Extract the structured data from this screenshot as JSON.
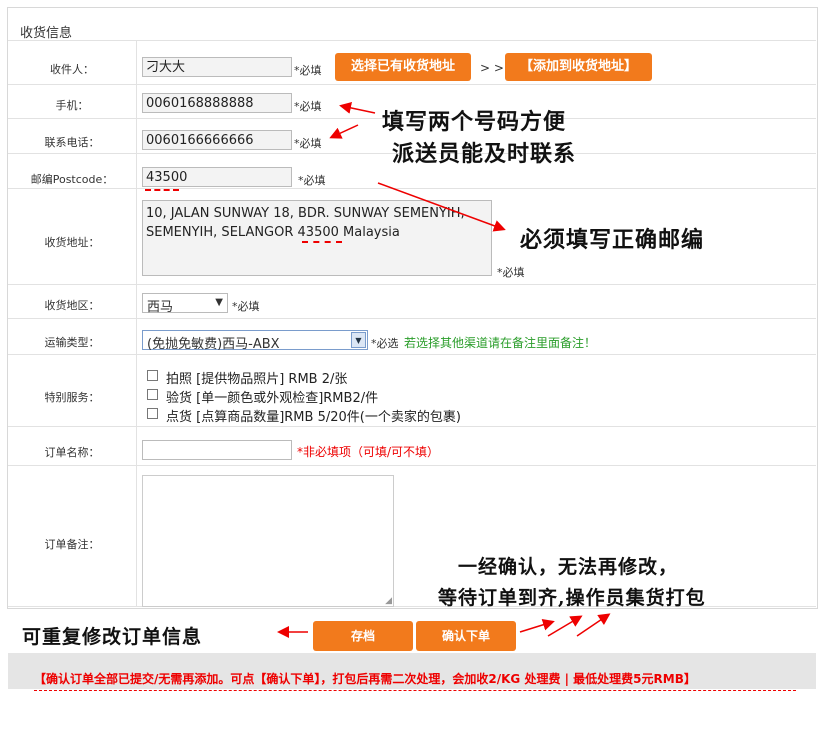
{
  "section_title": "收货信息",
  "recipient": {
    "label": "收件人：",
    "value": "刁大大",
    "req": "*必填"
  },
  "btn_select_address": "选择已有收货地址",
  "arrows_text": "> >",
  "btn_add_address": "【添加到收货地址】",
  "phone": {
    "label": "手机：",
    "value": "0060168888888",
    "req": "*必填"
  },
  "tel": {
    "label": "联系电话：",
    "value": "0060166666666",
    "req": "*必填"
  },
  "postcode": {
    "label": "邮编Postcode：",
    "value": "43500",
    "req": "*必填"
  },
  "address": {
    "label": "收货地址：",
    "value_line1": "10, JALAN SUNWAY 18, BDR. SUNWAY SEMENYIH,",
    "value_line2a": "SEMENYIH, SELANGOR ",
    "value_line2b": "43500",
    "value_line2c": " Malaysia",
    "req": "*必填"
  },
  "region": {
    "label": "收货地区：",
    "value": "西马",
    "req": "*必填"
  },
  "shipping": {
    "label": "运输类型：",
    "value": "(免抛免敏费)西马-ABX",
    "req": "*必选",
    "hint": "若选择其他渠道请在备注里面备注！"
  },
  "services": {
    "label": "特别服务：",
    "items": [
      "拍照 [提供物品照片] RMB 2/张",
      "验货 [单一颜色或外观检查]RMB2/件",
      "点货 [点算商品数量]RMB 5/20件(一个卖家的包裹)"
    ]
  },
  "order_name": {
    "label": "订单名称：",
    "value": "",
    "hint": "*非必填项（可填/可不填）"
  },
  "order_note": {
    "label": "订单备注：",
    "value": ""
  },
  "btn_save": "存档",
  "btn_confirm": "确认下单",
  "annotations": {
    "phones_1": "填写两个号码方便",
    "phones_2": "派送员能及时联系",
    "postcode": "必须填写正确邮编",
    "confirm_1": "一经确认，无法再修改，",
    "confirm_2": "等待订单到齐,操作员集货打包",
    "save": "可重复修改订单信息"
  },
  "notice": "【确认订单全部已提交/无需再添加。可点【确认下单】，打包后再需二次处理，会加收2/KG 处理费 | 最低处理费5元RMB】"
}
